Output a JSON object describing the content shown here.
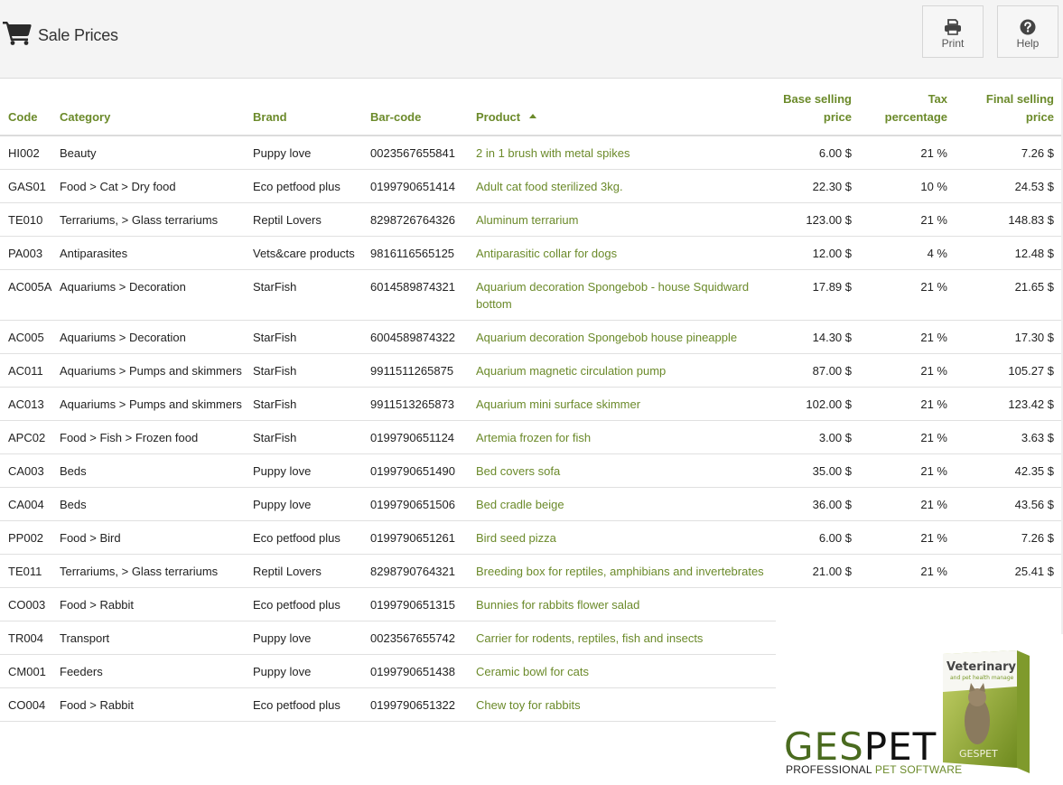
{
  "header": {
    "title": "Sale Prices",
    "title_icon": "shopping-cart-icon",
    "buttons": [
      {
        "label": "Print",
        "icon": "printer-icon"
      },
      {
        "label": "Help",
        "icon": "question-circle-icon"
      }
    ]
  },
  "table": {
    "sorted_by": "Product",
    "sort_direction": "ascending",
    "columns": [
      {
        "key": "code",
        "label": "Code"
      },
      {
        "key": "category",
        "label": "Category"
      },
      {
        "key": "brand",
        "label": "Brand"
      },
      {
        "key": "barcode",
        "label": "Bar-code"
      },
      {
        "key": "product",
        "label": "Product"
      },
      {
        "key": "base_price",
        "label": "Base selling price"
      },
      {
        "key": "tax",
        "label": "Tax percentage"
      },
      {
        "key": "final_price",
        "label": "Final selling price"
      }
    ],
    "rows": [
      {
        "code": "HI002",
        "category": "Beauty",
        "brand": "Puppy love",
        "barcode": "0023567655841",
        "product": "2 in 1 brush with metal spikes",
        "base_price": "6.00 $",
        "tax": "21 %",
        "final_price": "7.26 $"
      },
      {
        "code": "GAS01",
        "category": "Food > Cat > Dry food",
        "brand": "Eco petfood plus",
        "barcode": "0199790651414",
        "product": "Adult cat food sterilized 3kg.",
        "base_price": "22.30 $",
        "tax": "10 %",
        "final_price": "24.53 $"
      },
      {
        "code": "TE010",
        "category": "Terrariums, > Glass terrariums",
        "brand": "Reptil Lovers",
        "barcode": "8298726764326",
        "product": "Aluminum terrarium",
        "base_price": "123.00 $",
        "tax": "21 %",
        "final_price": "148.83 $"
      },
      {
        "code": "PA003",
        "category": "Antiparasites",
        "brand": "Vets&care products",
        "barcode": "9816116565125",
        "product": "Antiparasitic collar for dogs",
        "base_price": "12.00 $",
        "tax": "4 %",
        "final_price": "12.48 $"
      },
      {
        "code": "AC005A",
        "category": "Aquariums > Decoration",
        "brand": "StarFish",
        "barcode": "6014589874321",
        "product": "Aquarium decoration Spongebob - house Squidward bottom",
        "base_price": "17.89 $",
        "tax": "21 %",
        "final_price": "21.65 $"
      },
      {
        "code": "AC005",
        "category": "Aquariums > Decoration",
        "brand": "StarFish",
        "barcode": "6004589874322",
        "product": "Aquarium decoration Spongebob house pineapple",
        "base_price": "14.30 $",
        "tax": "21 %",
        "final_price": "17.30 $"
      },
      {
        "code": "AC011",
        "category": "Aquariums > Pumps and skimmers",
        "brand": "StarFish",
        "barcode": "9911511265875",
        "product": "Aquarium magnetic circulation pump",
        "base_price": "87.00 $",
        "tax": "21 %",
        "final_price": "105.27 $"
      },
      {
        "code": "AC013",
        "category": "Aquariums > Pumps and skimmers",
        "brand": "StarFish",
        "barcode": "9911513265873",
        "product": "Aquarium mini surface skimmer",
        "base_price": "102.00 $",
        "tax": "21 %",
        "final_price": "123.42 $"
      },
      {
        "code": "APC02",
        "category": "Food > Fish > Frozen food",
        "brand": "StarFish",
        "barcode": "0199790651124",
        "product": "Artemia frozen for fish",
        "base_price": "3.00 $",
        "tax": "21 %",
        "final_price": "3.63 $"
      },
      {
        "code": "CA003",
        "category": "Beds",
        "brand": "Puppy love",
        "barcode": "0199790651490",
        "product": "Bed covers sofa",
        "base_price": "35.00 $",
        "tax": "21 %",
        "final_price": "42.35 $"
      },
      {
        "code": "CA004",
        "category": "Beds",
        "brand": "Puppy love",
        "barcode": "0199790651506",
        "product": "Bed cradle beige",
        "base_price": "36.00 $",
        "tax": "21 %",
        "final_price": "43.56 $"
      },
      {
        "code": "PP002",
        "category": "Food > Bird",
        "brand": "Eco petfood plus",
        "barcode": "0199790651261",
        "product": "Bird seed pizza",
        "base_price": "6.00 $",
        "tax": "21 %",
        "final_price": "7.26 $"
      },
      {
        "code": "TE011",
        "category": "Terrariums, > Glass terrariums",
        "brand": "Reptil Lovers",
        "barcode": "8298790764321",
        "product": "Breeding box for reptiles, amphibians and invertebrates",
        "base_price": "21.00 $",
        "tax": "21 %",
        "final_price": "25.41 $"
      },
      {
        "code": "CO003",
        "category": "Food > Rabbit",
        "brand": "Eco petfood plus",
        "barcode": "0199790651315",
        "product": "Bunnies for rabbits flower salad",
        "base_price": "",
        "tax": "",
        "final_price": ""
      },
      {
        "code": "TR004",
        "category": "Transport",
        "brand": "Puppy love",
        "barcode": "0023567655742",
        "product": "Carrier for rodents, reptiles, fish and insects",
        "base_price": "",
        "tax": "",
        "final_price": ""
      },
      {
        "code": "CM001",
        "category": "Feeders",
        "brand": "Puppy love",
        "barcode": "0199790651438",
        "product": "Ceramic bowl for cats",
        "base_price": "",
        "tax": "",
        "final_price": ""
      },
      {
        "code": "CO004",
        "category": "Food > Rabbit",
        "brand": "Eco petfood plus",
        "barcode": "0199790651322",
        "product": "Chew toy for rabbits",
        "base_price": "",
        "tax": "",
        "final_price": ""
      }
    ]
  },
  "branding": {
    "logo_part1": "GES",
    "logo_part2": "PET",
    "tagline_part1": "PROFESSIONAL",
    "tagline_part2": "PET SOFTWARE",
    "box_title": "Veterinary",
    "box_subtitle": "and pet health manage",
    "box_side": "Veterinary and pet health manage",
    "box_logo": "GESPET"
  },
  "colors": {
    "accent": "#6b8a2a",
    "header_bg": "#f4f4f4",
    "logo_green": "#4a6b1f"
  }
}
